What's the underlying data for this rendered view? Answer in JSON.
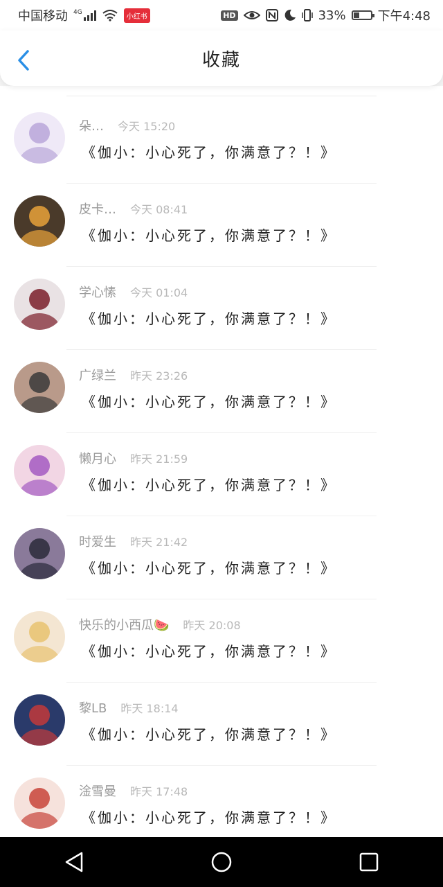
{
  "status_bar": {
    "carrier": "中国移动",
    "network": "4G",
    "badge": "小红书",
    "hd": "HD",
    "battery": "33%",
    "battery_level": 0.33,
    "time": "下午4:48"
  },
  "header": {
    "title": "收藏",
    "back_icon": "chevron-left-icon"
  },
  "items": [
    {
      "name": "朵…",
      "time": "今天 15:20",
      "message": "《伽小：小心死了，你满意了？！》",
      "avatar_colors": [
        "#b9a6d9",
        "#efe9f7"
      ]
    },
    {
      "name": "皮卡…",
      "time": "今天 08:41",
      "message": "《伽小：小心死了，你满意了？！》",
      "avatar_colors": [
        "#e8a23a",
        "#4a3a2a"
      ]
    },
    {
      "name": "学心愫",
      "time": "今天 01:04",
      "message": "《伽小：小心死了，你满意了？！》",
      "avatar_colors": [
        "#7a1e2a",
        "#e9e2e4"
      ]
    },
    {
      "name": "广绿兰",
      "time": "昨天 23:26",
      "message": "《伽小：小心死了，你满意了？！》",
      "avatar_colors": [
        "#3a3a3a",
        "#b99a8a"
      ]
    },
    {
      "name": "懒月心",
      "time": "昨天 21:59",
      "message": "《伽小：小心死了，你满意了？！》",
      "avatar_colors": [
        "#a45bc2",
        "#f2d6e4"
      ]
    },
    {
      "name": "时爱生",
      "time": "昨天 21:42",
      "message": "《伽小：小心死了，你满意了？！》",
      "avatar_colors": [
        "#2a2a3a",
        "#8a7a9a"
      ]
    },
    {
      "name": "快乐的小西瓜🍉",
      "time": "昨天 20:08",
      "message": "《伽小：小心死了，你满意了？！》",
      "avatar_colors": [
        "#e8c270",
        "#f4e6d2"
      ]
    },
    {
      "name": "黎LB",
      "time": "昨天 18:14",
      "message": "《伽小：小心死了，你满意了？！》",
      "avatar_colors": [
        "#c23a3a",
        "#2a3a6a"
      ]
    },
    {
      "name": "淦雪曼",
      "time": "昨天 17:48",
      "message": "《伽小：小心死了，你满意了？！》",
      "avatar_colors": [
        "#c8443a",
        "#f6e2dc"
      ]
    }
  ],
  "system_nav": {
    "back_icon": "triangle-back-icon",
    "home_icon": "circle-home-icon",
    "recents_icon": "square-recents-icon"
  }
}
